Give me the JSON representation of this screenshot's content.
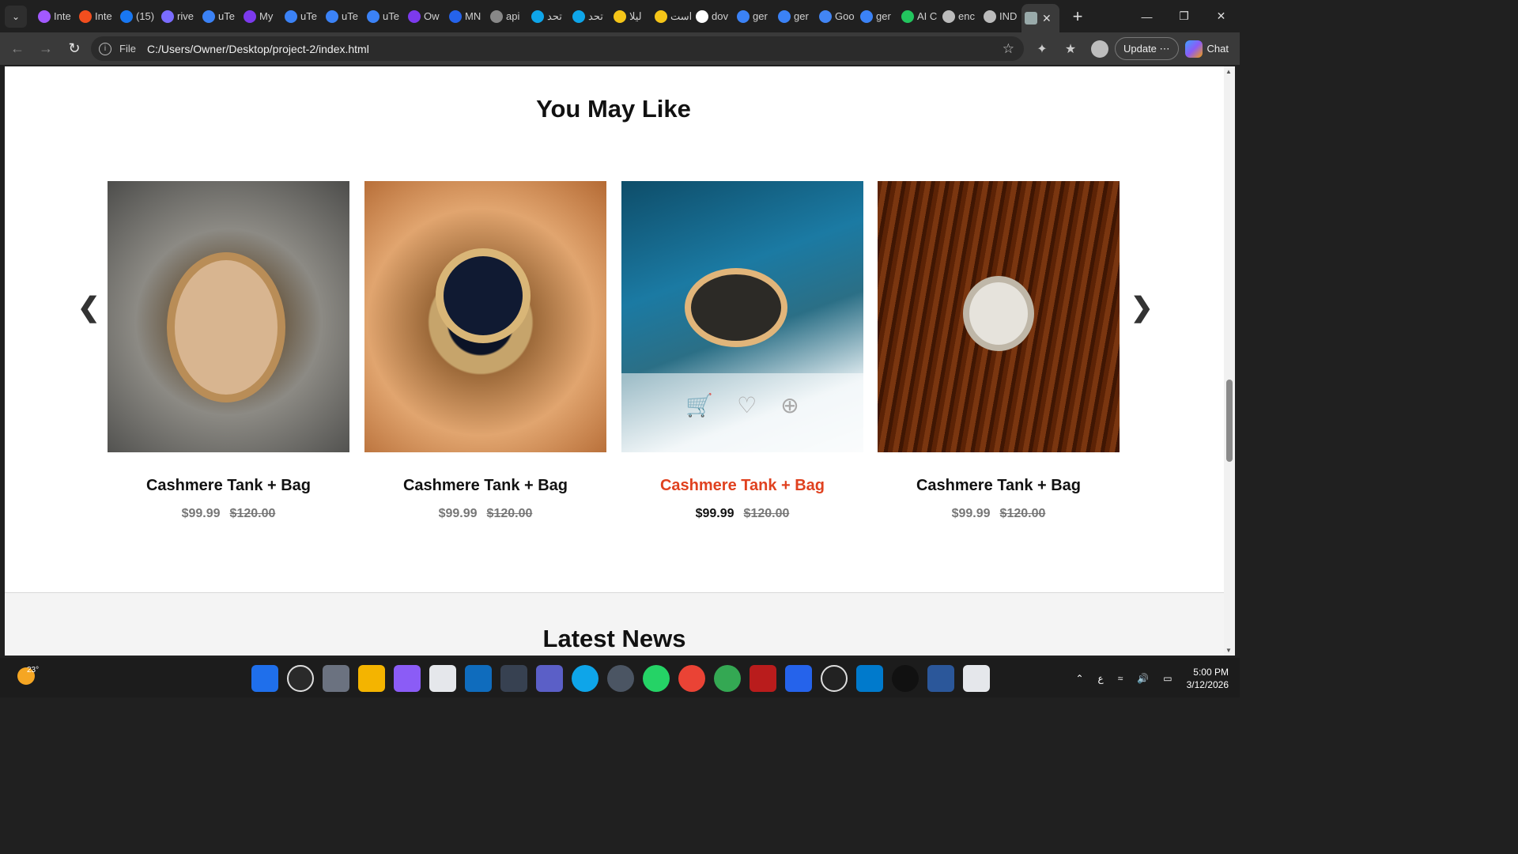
{
  "browser": {
    "tabs": [
      {
        "label": "Inte",
        "color": "#a259ff"
      },
      {
        "label": "Inte",
        "color": "#f24e1e"
      },
      {
        "label": "(15)",
        "color": "#1877f2"
      },
      {
        "label": "rive",
        "color": "#7a6cff"
      },
      {
        "label": "uTe",
        "color": "#3b82f6"
      },
      {
        "label": "My",
        "color": "#7c3aed"
      },
      {
        "label": "uTe",
        "color": "#3b82f6"
      },
      {
        "label": "uTe",
        "color": "#3b82f6"
      },
      {
        "label": "uTe",
        "color": "#3b82f6"
      },
      {
        "label": "Ow",
        "color": "#7c3aed"
      },
      {
        "label": "MN",
        "color": "#2563eb"
      },
      {
        "label": "api",
        "color": "#888888"
      },
      {
        "label": "تحد",
        "color": "#0ea5e9"
      },
      {
        "label": "تحد",
        "color": "#0ea5e9"
      },
      {
        "label": "ليلا",
        "color": "#f5c518"
      },
      {
        "label": "است",
        "color": "#f5c518"
      },
      {
        "label": "dov",
        "color": "#ffffff"
      },
      {
        "label": "ger",
        "color": "#3b82f6"
      },
      {
        "label": "ger",
        "color": "#3b82f6"
      },
      {
        "label": "Goo",
        "color": "#4285f4"
      },
      {
        "label": "ger",
        "color": "#3b82f6"
      },
      {
        "label": "AI C",
        "color": "#22c55e"
      },
      {
        "label": "enc",
        "color": "#bbbbbb"
      },
      {
        "label": "IND",
        "color": "#bbbbbb"
      }
    ],
    "url_scheme": "File",
    "url": "C:/Users/Owner/Desktop/project-2/index.html",
    "update_label": "Update",
    "chat_label": "Chat"
  },
  "page": {
    "section_title": "You May Like",
    "products": [
      {
        "name": "Cashmere Tank + Bag",
        "price": "$99.99",
        "old_price": "$120.00"
      },
      {
        "name": "Cashmere Tank + Bag",
        "price": "$99.99",
        "old_price": "$120.00"
      },
      {
        "name": "Cashmere Tank + Bag",
        "price": "$99.99",
        "old_price": "$120.00",
        "hovered": true
      },
      {
        "name": "Cashmere Tank + Bag",
        "price": "$99.99",
        "old_price": "$120.00"
      }
    ],
    "news_title": "Latest News"
  },
  "taskbar": {
    "temperature": "23°",
    "time": "5:00 PM",
    "date": "3/12/2026",
    "lang": "ع"
  },
  "colors": {
    "accent": "#e0411f",
    "browser_dark": "#202020"
  }
}
